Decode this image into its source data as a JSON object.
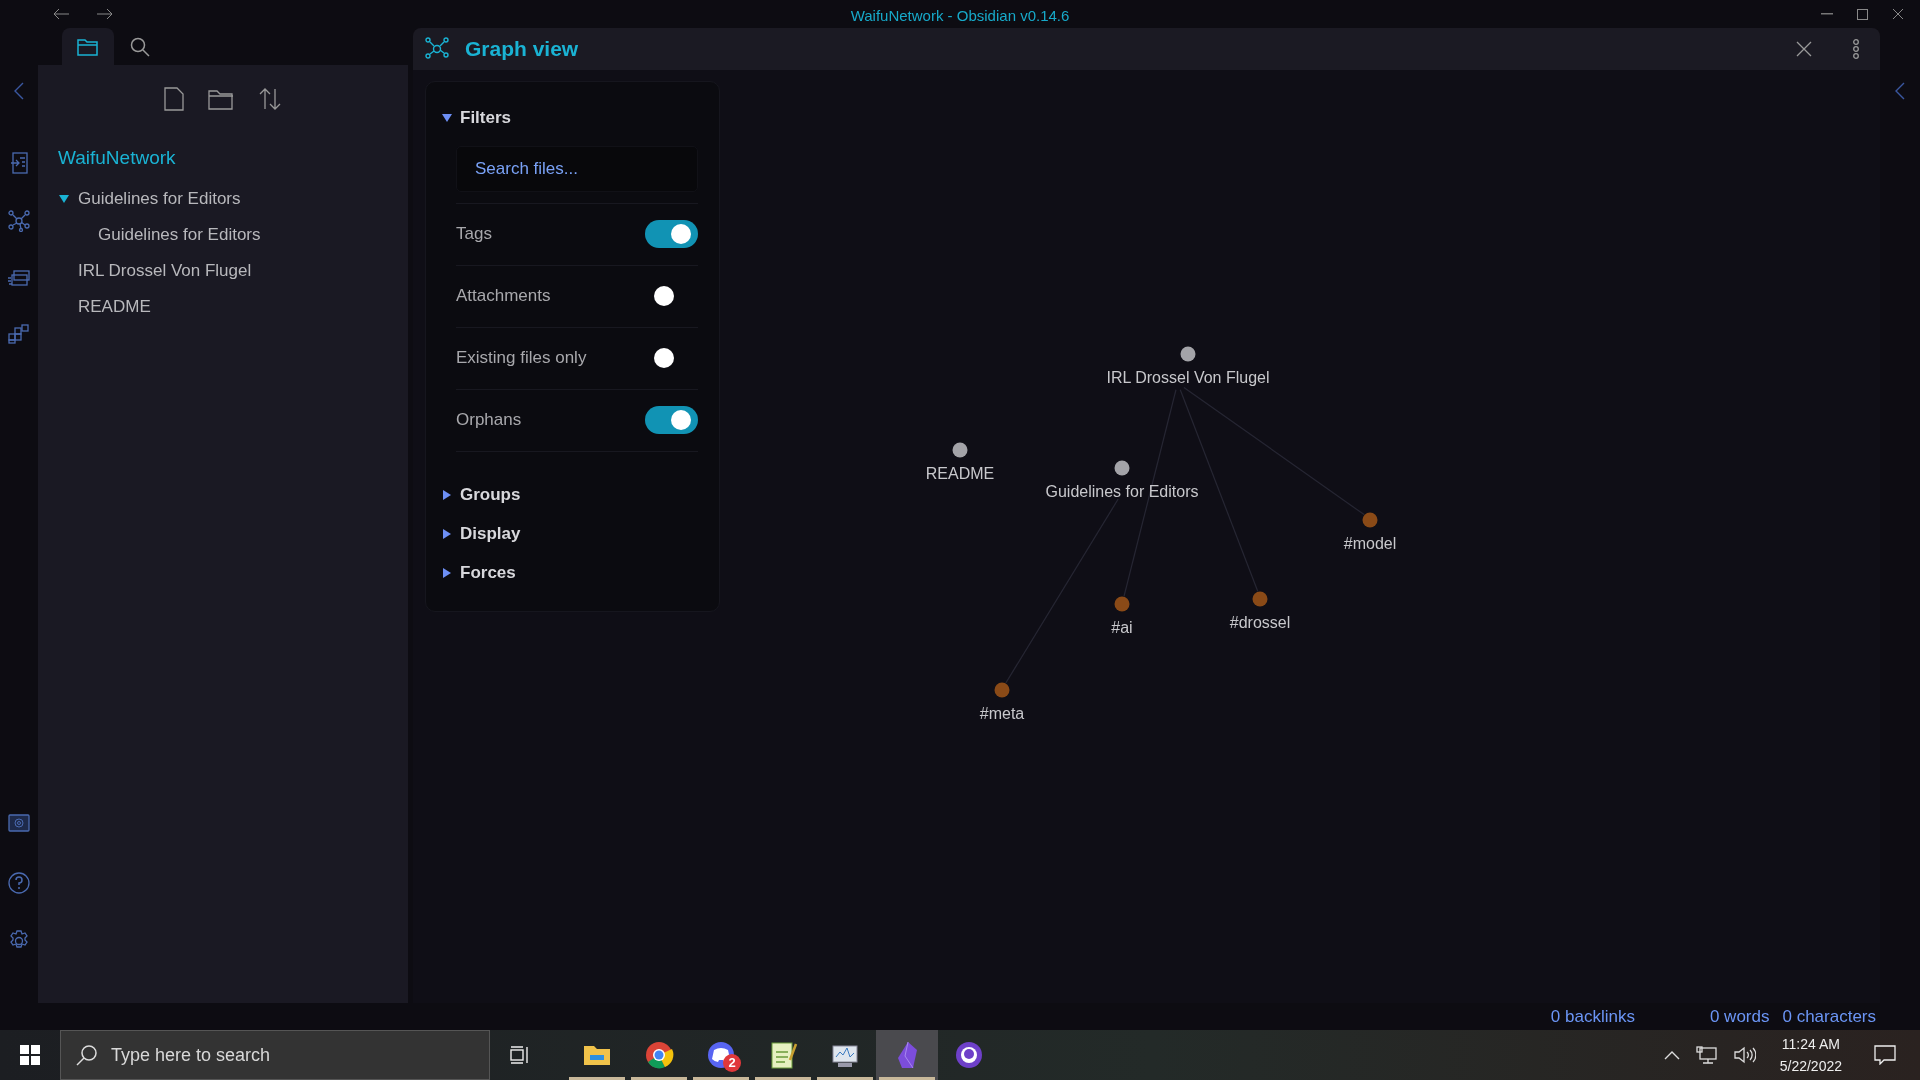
{
  "window": {
    "title": "WaifuNetwork - Obsidian v0.14.6"
  },
  "sidebar": {
    "tabs": [
      {
        "kind": "files",
        "selected": true
      },
      {
        "kind": "search",
        "selected": false
      }
    ],
    "vault": "WaifuNetwork",
    "items": [
      {
        "label": "Guidelines for Editors",
        "kind": "folder",
        "expanded": true,
        "children": [
          {
            "label": "Guidelines for Editors",
            "kind": "file"
          }
        ]
      },
      {
        "label": "IRL Drossel Von Flugel",
        "kind": "file"
      },
      {
        "label": "README",
        "kind": "file"
      }
    ]
  },
  "graph_view": {
    "title": "Graph view",
    "filters": {
      "title": "Filters",
      "expanded": true,
      "search": {
        "placeholder": "Search files..."
      },
      "toggles": [
        {
          "label": "Tags",
          "on": true
        },
        {
          "label": "Attachments",
          "on": false
        },
        {
          "label": "Existing files only",
          "on": false
        },
        {
          "label": "Orphans",
          "on": true
        }
      ]
    },
    "sections": [
      {
        "title": "Groups",
        "expanded": false
      },
      {
        "title": "Display",
        "expanded": false
      },
      {
        "title": "Forces",
        "expanded": false
      }
    ],
    "nodes": [
      {
        "label": "IRL Drossel Von Flugel",
        "color": "#a3a3a8"
      },
      {
        "label": "README",
        "color": "#a3a3a8"
      },
      {
        "label": "Guidelines for Editors",
        "color": "#a3a3a8"
      },
      {
        "label": "#model",
        "color": "#8a4a17"
      },
      {
        "label": "#ai",
        "color": "#8a4a17"
      },
      {
        "label": "#drossel",
        "color": "#8a4a17"
      },
      {
        "label": "#meta",
        "color": "#8a4a17"
      }
    ]
  },
  "status_bar": {
    "items": [
      "0 backlinks",
      "0 words",
      "0 characters"
    ]
  },
  "taskbar": {
    "search": {
      "placeholder": "Type here to search"
    },
    "apps": [
      {
        "kind": "explorer",
        "running": true,
        "selected": false
      },
      {
        "kind": "chrome",
        "running": true,
        "selected": false
      },
      {
        "kind": "discord",
        "running": true,
        "selected": false,
        "badge": "2"
      },
      {
        "kind": "notepad",
        "running": true,
        "selected": false
      },
      {
        "kind": "monitor",
        "running": true,
        "selected": false
      },
      {
        "kind": "obsidian",
        "running": true,
        "selected": true
      },
      {
        "kind": "github",
        "running": false,
        "selected": false
      }
    ],
    "clock": {
      "time": "11:24 AM",
      "date": "5/22/2022"
    }
  }
}
